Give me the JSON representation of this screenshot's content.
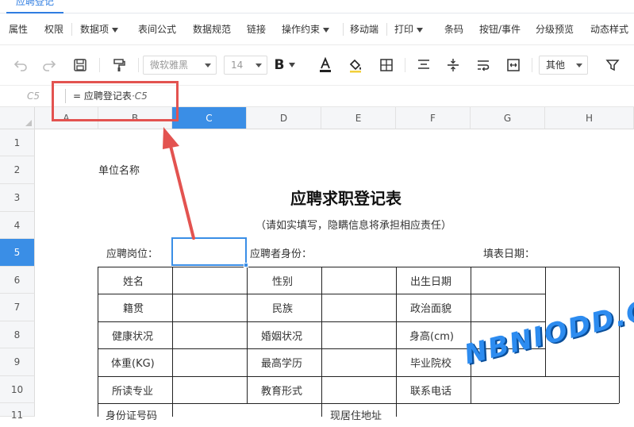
{
  "tab": {
    "label": "应聘登记"
  },
  "menu": {
    "items": [
      "属性",
      "权限",
      "数据项",
      "表间公式",
      "数据规范",
      "链接",
      "操作约束",
      "移动端",
      "打印",
      "条码",
      "按钮/事件",
      "分级预览",
      "动态样式"
    ]
  },
  "toolbar": {
    "font_family": "微软雅黑",
    "font_size": "14",
    "more_label": "其他",
    "icons": [
      "undo-icon",
      "redo-icon",
      "save-icon",
      "format-painter-icon",
      "bold-icon",
      "font-color-icon",
      "fill-color-icon",
      "border-icon",
      "align-top-icon",
      "align-middle-icon",
      "wrap-text-icon",
      "merge-cells-icon",
      "filter-icon"
    ],
    "font_color": "#222222",
    "fill_color": "#f2d03b"
  },
  "formula_bar": {
    "cell_ref": "C5",
    "prefix": "=",
    "formula_main": "应聘登记表",
    "formula_ref": "C5"
  },
  "grid": {
    "columns": [
      "A",
      "B",
      "C",
      "D",
      "E",
      "F",
      "G",
      "H"
    ],
    "active_column": "C",
    "rows": [
      "1",
      "2",
      "3",
      "4",
      "5",
      "6",
      "7",
      "8",
      "9",
      "10",
      "11"
    ],
    "active_row": "5",
    "selected_cell": "C5"
  },
  "sheet": {
    "unit_label": "单位名称",
    "title": "应聘求职登记表",
    "subtitle": "（请如实填写，隐瞒信息将承担相应责任）",
    "row5": {
      "position": "应聘岗位：",
      "applicant": "应聘者身份：",
      "date": "填表日期："
    },
    "table": [
      [
        "姓名",
        "性别",
        "出生日期"
      ],
      [
        "籍贯",
        "民族",
        "政治面貌"
      ],
      [
        "健康状况",
        "婚姻状况",
        "身高(cm)"
      ],
      [
        "体重(KG)",
        "最高学历",
        "毕业院校"
      ],
      [
        "所读专业",
        "教育形式",
        "联系电话"
      ]
    ],
    "row11": {
      "left": "身份证号码",
      "mid": "现居住地址"
    }
  },
  "colors": {
    "accent": "#3a8ee6",
    "annotation": "#e35350"
  },
  "watermark": {
    "text": "NBNIODD.COM"
  }
}
